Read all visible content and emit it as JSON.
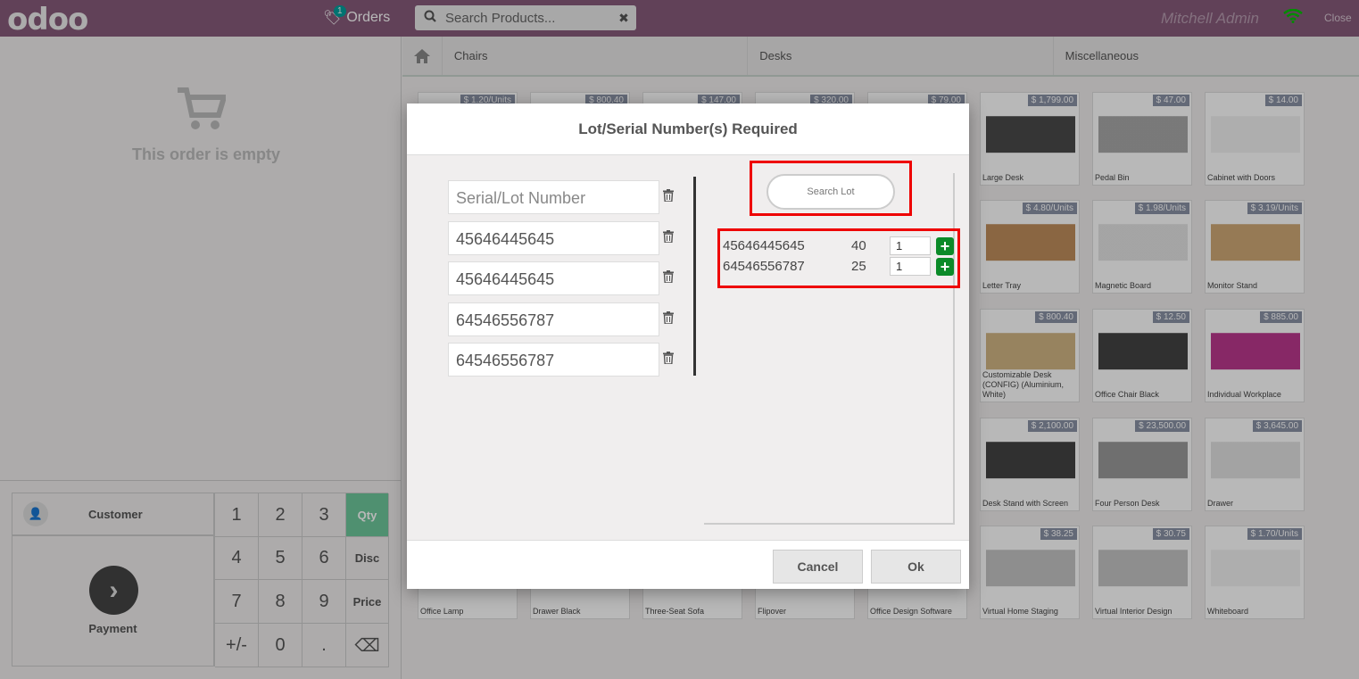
{
  "header": {
    "logo": "odoo",
    "orders_label": "Orders",
    "orders_count": "1",
    "search_placeholder": "Search Products...",
    "user": "Mitchell Admin",
    "close_label": "Close"
  },
  "order": {
    "empty_text": "This order is empty"
  },
  "pad": {
    "customer_label": "Customer",
    "payment_label": "Payment",
    "keys": [
      "1",
      "2",
      "3",
      "Qty",
      "4",
      "5",
      "6",
      "Disc",
      "7",
      "8",
      "9",
      "Price",
      "+/-",
      "0",
      ".",
      "⌫"
    ]
  },
  "categories": [
    "Chairs",
    "Desks",
    "Miscellaneous"
  ],
  "products": [
    {
      "name": "",
      "price": "$ 1.20/Units"
    },
    {
      "name": "",
      "price": "$ 800.40"
    },
    {
      "name": "",
      "price": "$ 147.00"
    },
    {
      "name": "",
      "price": "$ 320.00"
    },
    {
      "name": "",
      "price": "$ 79.00"
    },
    {
      "name": "Large Desk",
      "price": "$ 1,799.00"
    },
    {
      "name": "Pedal Bin",
      "price": "$ 47.00"
    },
    {
      "name": "Cabinet with Doors",
      "price": "$ 14.00"
    },
    {
      "name": "Letter Tray",
      "price": "$ 4.80/Units"
    },
    {
      "name": "Magnetic Board",
      "price": "$ 1.98/Units"
    },
    {
      "name": "Monitor Stand",
      "price": "$ 3.19/Units"
    },
    {
      "name": "Customizable Desk (CONFIG) (Aluminium, White)",
      "price": "$ 800.40"
    },
    {
      "name": "Office Chair Black",
      "price": "$ 12.50"
    },
    {
      "name": "Individual Workplace",
      "price": "$ 885.00"
    },
    {
      "name": "Desk Stand with Screen",
      "price": "$ 2,100.00"
    },
    {
      "name": "Four Person Desk",
      "price": "$ 23,500.00"
    },
    {
      "name": "Drawer",
      "price": "$ 3,645.00"
    },
    {
      "name": "Office Lamp",
      "price": ""
    },
    {
      "name": "Drawer Black",
      "price": ""
    },
    {
      "name": "Three-Seat Sofa",
      "price": ""
    },
    {
      "name": "Flipover",
      "price": ""
    },
    {
      "name": "Office Design Software",
      "price": ""
    },
    {
      "name": "Virtual Home Staging",
      "price": "$ 38.25"
    },
    {
      "name": "Virtual Interior Design",
      "price": "$ 30.75"
    },
    {
      "name": "Whiteboard",
      "price": "$ 1.70/Units"
    }
  ],
  "modal": {
    "title": "Lot/Serial Number(s) Required",
    "serial_placeholder": "Serial/Lot Number",
    "serials": [
      "45646445645",
      "45646445645",
      "64546556787",
      "64546556787"
    ],
    "search_lot_placeholder": "Search Lot",
    "lots": [
      {
        "number": "45646445645",
        "qty": "40",
        "input": "1"
      },
      {
        "number": "64546556787",
        "qty": "25",
        "input": "1"
      }
    ],
    "cancel_label": "Cancel",
    "ok_label": "Ok"
  }
}
